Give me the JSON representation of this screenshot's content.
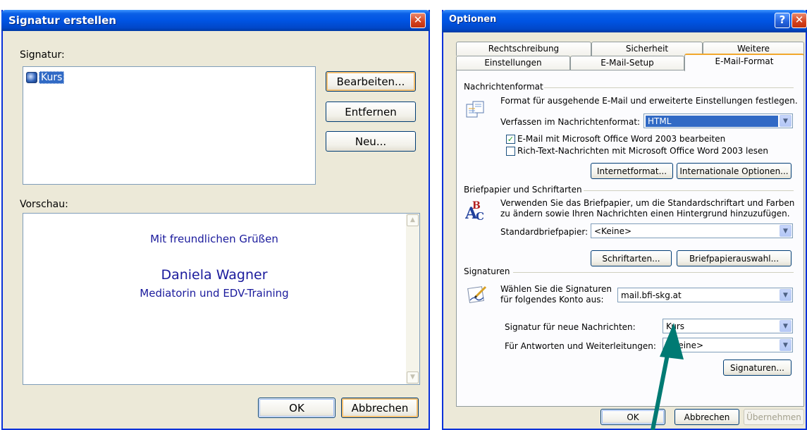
{
  "signatur_dialog": {
    "title": "Signatur erstellen",
    "signatur_label": "Signatur:",
    "signatures": [
      "Kurs"
    ],
    "buttons": {
      "bearbeiten": "Bearbeiten...",
      "entfernen": "Entfernen",
      "neu": "Neu...",
      "ok": "OK",
      "abbrechen": "Abbrechen"
    },
    "vorschau_label": "Vorschau:",
    "preview": {
      "line1": "Mit freundlichen Grüßen",
      "name": "Daniela Wagner",
      "role": "Mediatorin und EDV-Training",
      "text_color": "#1a1a9c"
    }
  },
  "optionen_dialog": {
    "title": "Optionen",
    "tabs_row1": [
      "Rechtschreibung",
      "Sicherheit",
      "Weitere"
    ],
    "tabs_row2": [
      "Einstellungen",
      "E-Mail-Setup",
      "E-Mail-Format"
    ],
    "active_tab": "E-Mail-Format",
    "nachrichtenformat": {
      "heading": "Nachrichtenformat",
      "description": "Format für ausgehende E-Mail und erweiterte Einstellungen festlegen.",
      "verfassen_label": "Verfassen im Nachrichtenformat:",
      "format_value": "HTML",
      "checkbox_word_edit": "E-Mail mit Microsoft Office Word 2003 bearbeiten",
      "checkbox_word_edit_checked": true,
      "checkbox_rich_text": "Rich-Text-Nachrichten mit Microsoft Office Word 2003 lesen",
      "checkbox_rich_text_checked": false,
      "internetformat_btn": "Internetformat...",
      "internationale_btn": "Internationale Optionen..."
    },
    "briefpapier": {
      "heading": "Briefpapier und Schriftarten",
      "description_line1": "Verwenden Sie das Briefpapier, um die Standardschriftart und Farben",
      "description_line2": "zu ändern sowie Ihren Nachrichten einen Hintergrund hinzuzufügen.",
      "standard_label": "Standardbriefpapier:",
      "standard_value": "<Keine>",
      "schriftarten_btn": "Schriftarten...",
      "briefpapierauswahl_btn": "Briefpapierauswahl..."
    },
    "signaturen": {
      "heading": "Signaturen",
      "konto_label_line1": "Wählen Sie die Signaturen",
      "konto_label_line2": "für folgendes Konto aus:",
      "konto_value": "mail.bfi-skg.at",
      "neue_label": "Signatur für neue Nachrichten:",
      "neue_value": "Kurs",
      "antworten_label": "Für Antworten und Weiterleitungen:",
      "antworten_value": "<Keine>",
      "signaturen_btn": "Signaturen..."
    },
    "buttons": {
      "ok": "OK",
      "abbrechen": "Abbrechen",
      "uebernehmen": "Übernehmen"
    }
  },
  "colors": {
    "titlebar": "#0054e3",
    "dialog_bg": "#ece9d8",
    "arrow": "#007a73",
    "selection": "#316ac5"
  }
}
